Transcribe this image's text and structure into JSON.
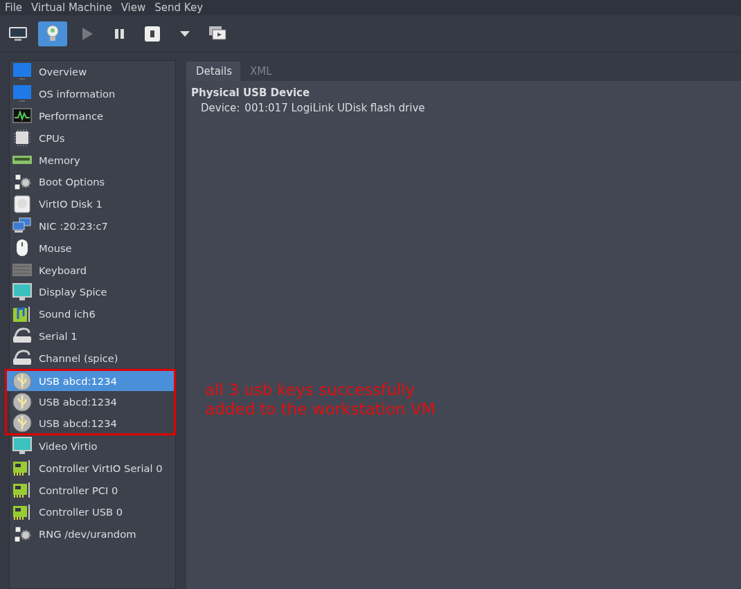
{
  "menu_bar": [
    "File",
    "Virtual Machine",
    "View",
    "Send Key"
  ],
  "toolbar": [
    {
      "kind": "monitor",
      "selected": false,
      "disabled": false
    },
    {
      "kind": "bulb",
      "selected": true,
      "disabled": false
    },
    {
      "kind": "play",
      "selected": false,
      "disabled": true
    },
    {
      "kind": "pause",
      "selected": false,
      "disabled": false
    },
    {
      "kind": "power",
      "selected": false,
      "disabled": false
    },
    {
      "kind": "caret",
      "selected": false,
      "disabled": false
    },
    {
      "kind": "screens",
      "selected": false,
      "disabled": false
    }
  ],
  "sidebar": {
    "items": [
      {
        "label": "Overview",
        "kind": "screen",
        "selected": false,
        "highlighted": false
      },
      {
        "label": "OS information",
        "kind": "screen",
        "selected": false,
        "highlighted": false
      },
      {
        "label": "Performance",
        "kind": "chart",
        "selected": false,
        "highlighted": false
      },
      {
        "label": "CPUs",
        "kind": "chip",
        "selected": false,
        "highlighted": false
      },
      {
        "label": "Memory",
        "kind": "memory",
        "selected": false,
        "highlighted": false
      },
      {
        "label": "Boot Options",
        "kind": "gears",
        "selected": false,
        "highlighted": false
      },
      {
        "label": "VirtIO Disk 1",
        "kind": "disk",
        "selected": false,
        "highlighted": false
      },
      {
        "label": "NIC :20:23:c7",
        "kind": "network",
        "selected": false,
        "highlighted": false
      },
      {
        "label": "Mouse",
        "kind": "mouse",
        "selected": false,
        "highlighted": false
      },
      {
        "label": "Keyboard",
        "kind": "keyboard",
        "selected": false,
        "highlighted": false
      },
      {
        "label": "Display Spice",
        "kind": "display",
        "selected": false,
        "highlighted": false
      },
      {
        "label": "Sound ich6",
        "kind": "sound",
        "selected": false,
        "highlighted": false
      },
      {
        "label": "Serial 1",
        "kind": "serial",
        "selected": false,
        "highlighted": false
      },
      {
        "label": "Channel (spice)",
        "kind": "serial",
        "selected": false,
        "highlighted": false
      },
      {
        "label": "USB abcd:1234",
        "kind": "usb",
        "selected": true,
        "highlighted": true
      },
      {
        "label": "USB abcd:1234",
        "kind": "usb",
        "selected": false,
        "highlighted": true
      },
      {
        "label": "USB abcd:1234",
        "kind": "usb",
        "selected": false,
        "highlighted": true
      },
      {
        "label": "Video Virtio",
        "kind": "display",
        "selected": false,
        "highlighted": false
      },
      {
        "label": "Controller VirtIO Serial 0",
        "kind": "card",
        "selected": false,
        "highlighted": false
      },
      {
        "label": "Controller PCI 0",
        "kind": "card",
        "selected": false,
        "highlighted": false
      },
      {
        "label": "Controller USB 0",
        "kind": "card",
        "selected": false,
        "highlighted": false
      },
      {
        "label": "RNG /dev/urandom",
        "kind": "gears",
        "selected": false,
        "highlighted": false
      }
    ]
  },
  "tabs": [
    {
      "label": "Details",
      "selected": true
    },
    {
      "label": "XML",
      "selected": false
    }
  ],
  "details": {
    "heading": "Physical USB Device",
    "field_label": "Device:",
    "field_value": "001:017 LogiLink UDisk flash drive"
  },
  "annotation": [
    "all 3 usb keys successfully",
    "added to the workstation VM"
  ]
}
